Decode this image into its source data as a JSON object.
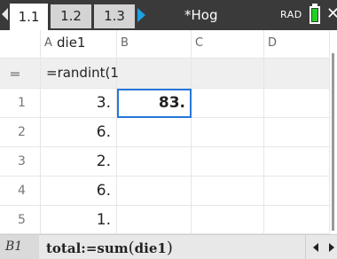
{
  "tabs": [
    {
      "label": "1.1",
      "active": true
    },
    {
      "label": "1.2",
      "active": false
    },
    {
      "label": "1.3",
      "active": false
    }
  ],
  "document_title": "*Hog",
  "angle_mode": "RAD",
  "columns": [
    {
      "letter": "A",
      "name": "die1"
    },
    {
      "letter": "B",
      "name": ""
    },
    {
      "letter": "C",
      "name": ""
    },
    {
      "letter": "D",
      "name": ""
    }
  ],
  "formula_row": {
    "symbol": "=",
    "column_a": "=randint(1"
  },
  "rows": [
    {
      "num": "1",
      "a": "3.",
      "b": "83."
    },
    {
      "num": "2",
      "a": "6.",
      "b": ""
    },
    {
      "num": "3",
      "a": "2.",
      "b": ""
    },
    {
      "num": "4",
      "a": "6.",
      "b": ""
    },
    {
      "num": "5",
      "a": "1.",
      "b": ""
    }
  ],
  "status": {
    "cell_ref": "B1",
    "formula_prefix": "total:=sum",
    "formula_arg": "die1"
  },
  "colors": {
    "tabbar": "#3a3a3a",
    "accent": "#1ea0e6",
    "selection": "#2677d9",
    "battery": "#22d022"
  }
}
